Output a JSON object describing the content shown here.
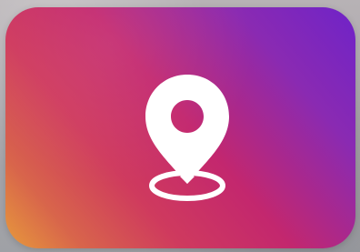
{
  "tile": {
    "icon": "map-pin-icon",
    "gradient_colors": [
      "#6f23c8",
      "#8a2ab2",
      "#c3276e",
      "#cf3a5e",
      "#d8654b",
      "#e79a3b"
    ],
    "icon_color": "#ffffff"
  }
}
